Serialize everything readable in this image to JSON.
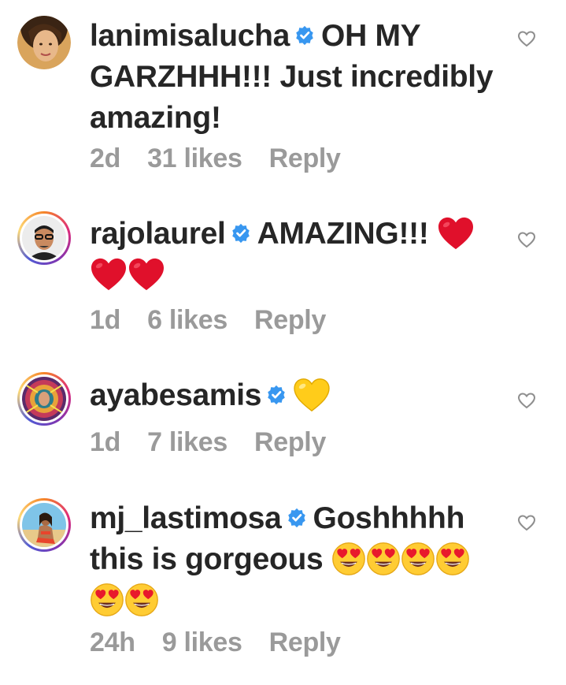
{
  "comments": [
    {
      "username": "lanimisalucha",
      "text_lines": [
        "OH MY",
        "GARZHHH!!! Just incredibly",
        "amazing!"
      ],
      "time": "2d",
      "likes": "31 likes",
      "reply": "Reply",
      "emojis": []
    },
    {
      "username": "rajolaurel",
      "text_lines": [
        "AMAZING!!!"
      ],
      "time": "1d",
      "likes": "6 likes",
      "reply": "Reply",
      "emojis": [
        "red-heart",
        "red-heart",
        "red-heart"
      ]
    },
    {
      "username": "ayabesamis",
      "text_lines": [],
      "time": "1d",
      "likes": "7 likes",
      "reply": "Reply",
      "emojis": [
        "yellow-heart"
      ]
    },
    {
      "username": "mj_lastimosa",
      "text_lines": [
        "Goshhhhh",
        "this is gorgeous"
      ],
      "time": "24h",
      "likes": "9 likes",
      "reply": "Reply",
      "emojis": [
        "heart-eyes",
        "heart-eyes",
        "heart-eyes",
        "heart-eyes",
        "heart-eyes",
        "heart-eyes"
      ]
    }
  ],
  "colors": {
    "verified": "#3897f0",
    "meta_text": "#9a9a9a",
    "heart_red": "#e0102b",
    "heart_yellow": "#ffcc1a"
  },
  "icons": [
    "verified-badge-icon",
    "like-heart-icon",
    "red-heart-emoji",
    "yellow-heart-emoji",
    "heart-eyes-emoji"
  ]
}
